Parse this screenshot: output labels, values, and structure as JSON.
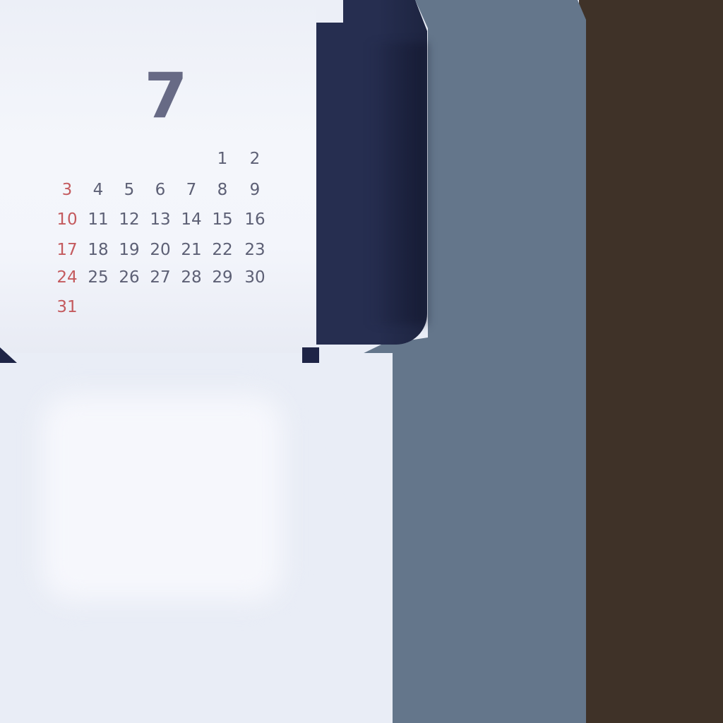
{
  "calendar": {
    "month": "7",
    "weeks": [
      [
        {
          "label": "",
          "sunday": true
        },
        {
          "label": ""
        },
        {
          "label": ""
        },
        {
          "label": ""
        },
        {
          "label": ""
        },
        {
          "label": "1"
        },
        {
          "label": "2"
        }
      ],
      [
        {
          "label": "3",
          "sunday": true
        },
        {
          "label": "4"
        },
        {
          "label": "5"
        },
        {
          "label": "6"
        },
        {
          "label": "7"
        },
        {
          "label": "8"
        },
        {
          "label": "9"
        }
      ],
      [
        {
          "label": "10",
          "sunday": true
        },
        {
          "label": "11"
        },
        {
          "label": "12"
        },
        {
          "label": "13"
        },
        {
          "label": "14"
        },
        {
          "label": "15"
        },
        {
          "label": "16"
        }
      ],
      [
        {
          "label": "17",
          "sunday": true
        },
        {
          "label": "18"
        },
        {
          "label": "19"
        },
        {
          "label": "20"
        },
        {
          "label": "21"
        },
        {
          "label": "22"
        },
        {
          "label": "23"
        }
      ],
      [
        {
          "label": "24",
          "sunday": true
        },
        {
          "label": "25"
        },
        {
          "label": "26"
        },
        {
          "label": "27"
        },
        {
          "label": "28"
        },
        {
          "label": "29"
        },
        {
          "label": "30"
        }
      ],
      [
        {
          "label": "31",
          "sunday": true
        },
        {
          "label": ""
        },
        {
          "label": ""
        },
        {
          "label": ""
        },
        {
          "label": ""
        },
        {
          "label": ""
        },
        {
          "label": ""
        }
      ]
    ]
  },
  "colors": {
    "month_text": "#676a85",
    "weekday_text": "#5d6075",
    "sunday_text": "#c45a5e",
    "card_background": "#f3f5fb",
    "dark_panel": "#262e50",
    "slate_wall": "#64768b",
    "brown_wall": "#3f3228"
  }
}
